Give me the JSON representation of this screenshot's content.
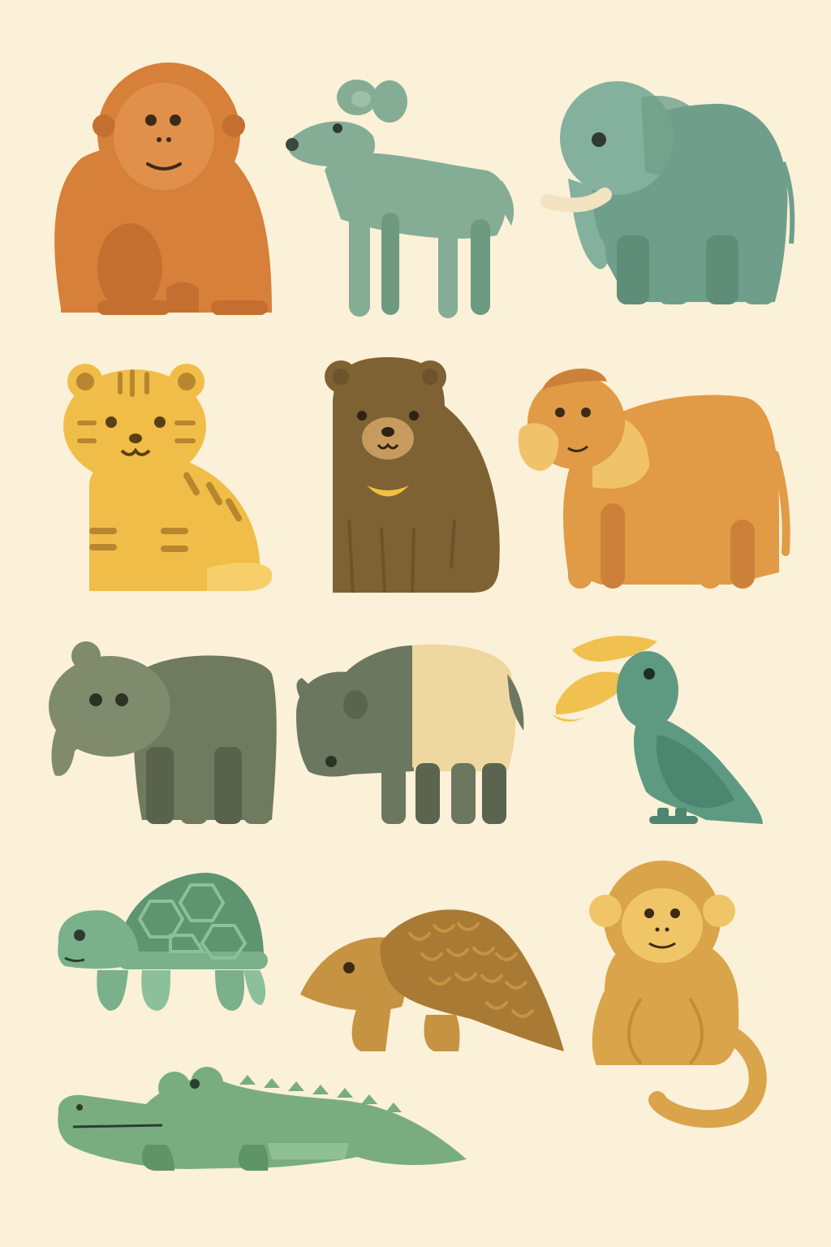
{
  "background": "#fbf0d8",
  "animals": [
    {
      "name": "orangutan",
      "icon": "orangutan-icon",
      "body": "#d6803a",
      "dark": "#c46f30",
      "light": "#e0904a"
    },
    {
      "name": "mouse-deer",
      "icon": "mouse-deer-icon",
      "body": "#85ad95",
      "dark": "#6f9a82",
      "light": "#9cc0a8"
    },
    {
      "name": "elephant",
      "icon": "elephant-icon",
      "body": "#6f9f8a",
      "dark": "#5e8d78",
      "light": "#84b19d",
      "tusk": "#f3e3c0"
    },
    {
      "name": "tiger-cub",
      "icon": "tiger-cub-icon",
      "body": "#f0bd48",
      "dark": "#b8862e",
      "light": "#f6cf6a"
    },
    {
      "name": "sun-bear",
      "icon": "sun-bear-icon",
      "body": "#7f6234",
      "dark": "#6d532b",
      "light": "#c79a5e",
      "chest": "#f2c23c"
    },
    {
      "name": "proboscis-monkey",
      "icon": "proboscis-monkey-icon",
      "body": "#e19a45",
      "dark": "#cc803a",
      "light": "#f0c26a"
    },
    {
      "name": "tapir-grey",
      "icon": "tapir-grey-icon",
      "body": "#6f7a5e",
      "dark": "#59634c",
      "light": "#808b6d"
    },
    {
      "name": "malayan-tapir",
      "icon": "malayan-tapir-icon",
      "body": "#6c7760",
      "dark": "#5a644f",
      "light": "#efd7a0"
    },
    {
      "name": "hornbill",
      "icon": "hornbill-icon",
      "body": "#5e9a82",
      "dark": "#4d8670",
      "light": "#f0c14e"
    },
    {
      "name": "tortoise",
      "icon": "tortoise-icon",
      "body": "#7ab08a",
      "dark": "#5e9470",
      "light": "#8cc09b"
    },
    {
      "name": "pangolin",
      "icon": "pangolin-icon",
      "body": "#c69343",
      "dark": "#a97a34",
      "light": "#d8a85a"
    },
    {
      "name": "macaque",
      "icon": "macaque-icon",
      "body": "#d9a44a",
      "dark": "#c28c3a",
      "light": "#f0c567"
    },
    {
      "name": "crocodile",
      "icon": "crocodile-icon",
      "body": "#79ad80",
      "dark": "#5f9467",
      "light": "#8fc094"
    }
  ]
}
